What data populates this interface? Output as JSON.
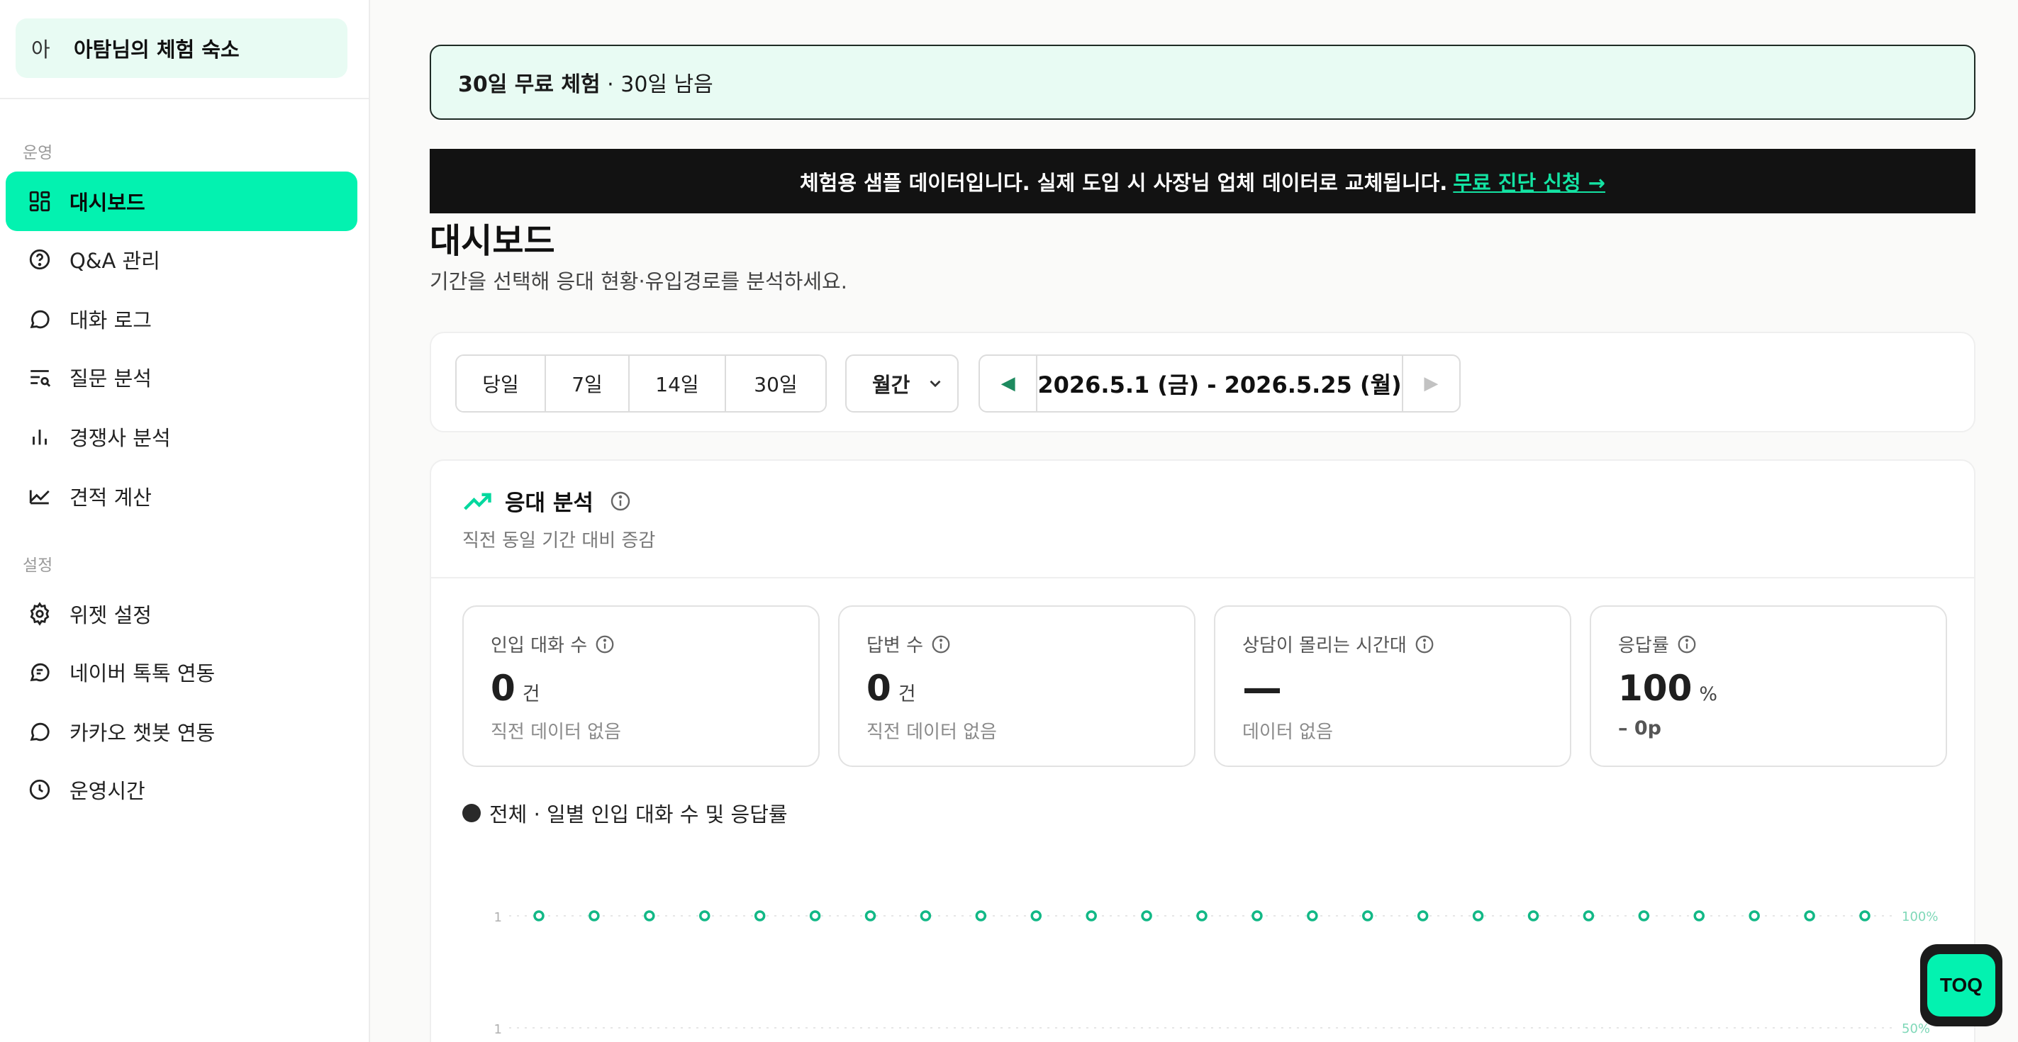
{
  "sidebar": {
    "org_avatar": "아",
    "org_name": "아탐님의 체험 숙소",
    "sections": {
      "operations": "운영",
      "settings": "설정"
    },
    "items": [
      {
        "label": "대시보드",
        "icon": "dashboard-icon",
        "active": true
      },
      {
        "label": "Q&A 관리",
        "icon": "question-circle-icon"
      },
      {
        "label": "대화 로그",
        "icon": "chat-bubble-icon"
      },
      {
        "label": "질문 분석",
        "icon": "list-search-icon"
      },
      {
        "label": "경쟁사 분석",
        "icon": "bar-chart-icon"
      },
      {
        "label": "견적 계산",
        "icon": "trend-chart-icon"
      },
      {
        "label": "위젯 설정",
        "icon": "gear-icon"
      },
      {
        "label": "네이버 톡톡 연동",
        "icon": "talk-bubble-icon"
      },
      {
        "label": "카카오 챗봇 연동",
        "icon": "chat-bubble-icon"
      },
      {
        "label": "운영시간",
        "icon": "clock-icon"
      }
    ]
  },
  "trial_banner": {
    "bold": "30일 무료 체험",
    "rest": " · 30일 남음"
  },
  "sample_notice": {
    "text": "체험용 샘플 데이터입니다. 실제 도입 시 사장님 업체 데이터로 교체됩니다.",
    "link": "무료 진단 신청 →"
  },
  "page": {
    "title": "대시보드",
    "subtitle": "기간을 선택해 응대 현황·유입경로를 분석하세요."
  },
  "filters": {
    "ranges": [
      "당일",
      "7일",
      "14일",
      "30일"
    ],
    "period": "월간",
    "prev": "◀",
    "next": "▶",
    "date_range": "2026.5.1 (금) - 2026.5.25 (월)"
  },
  "analysis": {
    "title": "응대 분석",
    "subtitle": "직전 동일 기간 대비 증감",
    "metrics": [
      {
        "label": "인입 대화 수",
        "value": "0",
        "unit": "건",
        "foot": "직전 데이터 없음"
      },
      {
        "label": "답변 수",
        "value": "0",
        "unit": "건",
        "foot": "직전 데이터 없음"
      },
      {
        "label": "상담이 몰리는 시간대",
        "value": "—",
        "unit": "",
        "foot": "데이터 없음"
      },
      {
        "label": "응답률",
        "value": "100",
        "unit": "%",
        "foot": "– 0p"
      }
    ],
    "chart_title": "전체 · 일별 인입 대화 수 및 응답률"
  },
  "chart_data": {
    "type": "line",
    "series": [
      {
        "name": "응답률",
        "values": [
          100,
          100,
          100,
          100,
          100,
          100,
          100,
          100,
          100,
          100,
          100,
          100,
          100,
          100,
          100,
          100,
          100,
          100,
          100,
          100,
          100,
          100,
          100,
          100,
          100
        ]
      }
    ],
    "y_left_ticks": [
      "1",
      "1"
    ],
    "y_right_ticks": [
      "100%",
      "50%"
    ],
    "grid": true,
    "colors": {
      "line": "#12b886",
      "grid": "#e6e6e6"
    }
  },
  "fab": {
    "label": "TOQ"
  },
  "colors": {
    "accent": "#03f2b0",
    "banner_bg": "#e8fbf3",
    "notice_bg": "#121212",
    "link": "#14e3a3"
  }
}
